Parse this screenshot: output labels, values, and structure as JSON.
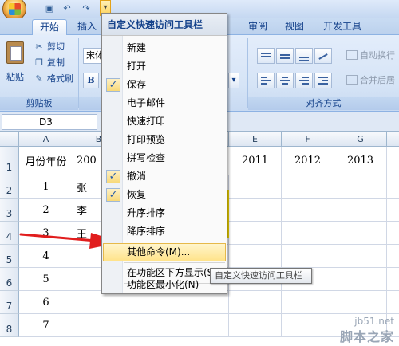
{
  "ribbon": {
    "tabs": [
      {
        "label": "开始",
        "active": true
      },
      {
        "label": "插入",
        "active": false
      },
      {
        "label": "审阅",
        "active": false
      },
      {
        "label": "视图",
        "active": false
      },
      {
        "label": "开发工具",
        "active": false
      }
    ],
    "clipboard": {
      "paste_label": "粘贴",
      "cut_label": "剪切",
      "copy_label": "复制",
      "format_painter_label": "格式刷",
      "group_label": "剪贴板"
    },
    "font": {
      "name_value": "宋体",
      "bold_label": "B"
    },
    "alignment": {
      "wrap_text_label": "自动换行",
      "merge_label": "合并后居",
      "group_label": "对齐方式"
    }
  },
  "formula_bar": {
    "name_box_value": "D3"
  },
  "sheet": {
    "columns": [
      "A",
      "B",
      "E",
      "F",
      "G"
    ],
    "row_numbers": [
      "1",
      "2",
      "3",
      "4",
      "5",
      "6",
      "7",
      "8"
    ],
    "header_row": {
      "a": "月份年份",
      "b": "200",
      "e": "2011",
      "f": "2012",
      "g": "2013"
    },
    "rows": [
      {
        "a": "1",
        "b": "张"
      },
      {
        "a": "2",
        "b": "李"
      },
      {
        "a": "3",
        "b": "王"
      },
      {
        "a": "4",
        "b": ""
      },
      {
        "a": "5",
        "b": ""
      },
      {
        "a": "6",
        "b": ""
      },
      {
        "a": "7",
        "b": ""
      }
    ]
  },
  "quick_access_menu": {
    "title": "自定义快速访问工具栏",
    "items": [
      {
        "label": "新建",
        "checked": false
      },
      {
        "label": "打开",
        "checked": false
      },
      {
        "label": "保存",
        "checked": true
      },
      {
        "label": "电子邮件",
        "checked": false
      },
      {
        "label": "快速打印",
        "checked": false
      },
      {
        "label": "打印预览",
        "checked": false
      },
      {
        "label": "拼写检查",
        "checked": false
      },
      {
        "label": "撤消",
        "checked": true
      },
      {
        "label": "恢复",
        "checked": true
      },
      {
        "label": "升序排序",
        "checked": false
      },
      {
        "label": "降序排序",
        "checked": false
      }
    ],
    "more_commands": "其他命令(M)...",
    "show_below_ribbon": "在功能区下方显示(S)",
    "minimize_ribbon": "功能区最小化(N)",
    "check_glyph": "✓"
  },
  "tooltip": {
    "text": "自定义快速访问工具栏"
  },
  "watermark": {
    "site": "jb51.net",
    "name": "脚本之家"
  },
  "colors": {
    "menu_highlight": "#ffe38a",
    "arrow": "#e11d1d",
    "divider_line": "#e23b3b"
  }
}
